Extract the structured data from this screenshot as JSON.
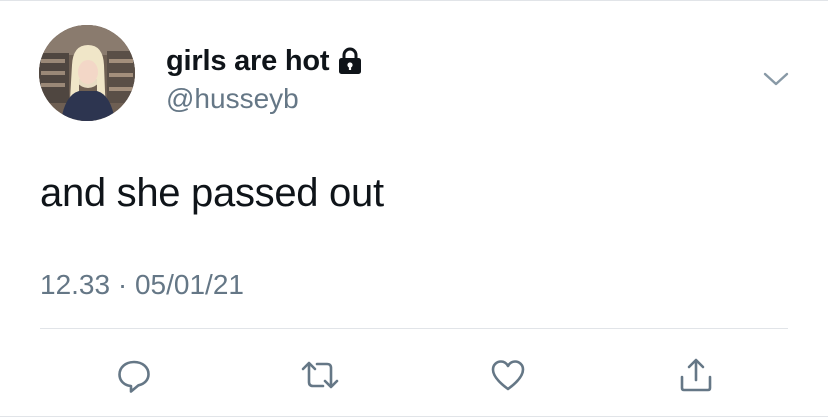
{
  "tweet": {
    "display_name": "girls are hot",
    "handle": "@husseyb",
    "text": "and she passed out",
    "time": "12.33",
    "separator": " · ",
    "date": "05/01/21"
  },
  "icons": {
    "protected": "lock-icon",
    "menu": "chevron-down-icon",
    "reply": "reply-icon",
    "retweet": "retweet-icon",
    "like": "heart-icon",
    "share": "share-icon"
  },
  "colors": {
    "text_primary": "#0f1419",
    "text_secondary": "#657786",
    "icon_gray": "#657786",
    "divider": "#e1e4e8"
  }
}
